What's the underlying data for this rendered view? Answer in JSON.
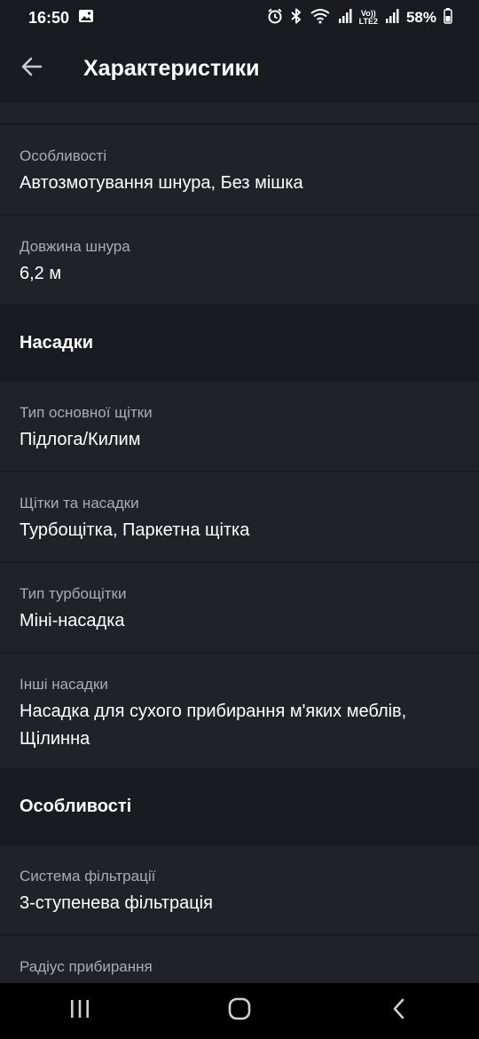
{
  "status_bar": {
    "time": "16:50",
    "battery": "58%",
    "volte_top": "Vo))",
    "volte_bottom": "LTE2",
    "icons": [
      "gallery-icon",
      "alarm-icon",
      "bluetooth-icon",
      "wifi-icon",
      "signal-icon",
      "battery-icon"
    ]
  },
  "header": {
    "title": "Характеристики",
    "back_icon": "arrow-left-icon"
  },
  "specs_top": [
    {
      "label": "Особливості",
      "value": "Автозмотування шнура, Без мішка"
    },
    {
      "label": "Довжина шнура",
      "value": "6,2 м"
    }
  ],
  "section_nozzles": {
    "title": "Насадки",
    "items": [
      {
        "label": "Тип основної щітки",
        "value": "Підлога/Килим"
      },
      {
        "label": "Щітки та насадки",
        "value": "Турбощітка, Паркетна щітка"
      },
      {
        "label": "Тип турбощітки",
        "value": "Міні-насадка"
      },
      {
        "label": "Інші насадки",
        "value": "Насадка для сухого прибирання м'яких меблів, Щілинна"
      }
    ]
  },
  "section_features": {
    "title": "Особливості",
    "items": [
      {
        "label": "Система фільтрації",
        "value": "3-ступенева фільтрація"
      },
      {
        "label": "Радіус прибирання",
        "value": ""
      }
    ]
  },
  "nav_bar": {
    "icons": [
      "recent-apps-icon",
      "home-icon",
      "back-icon"
    ]
  },
  "colors": {
    "background": "#181b20",
    "card": "#1f2328",
    "label": "#a9adb3",
    "text": "#ffffff"
  }
}
